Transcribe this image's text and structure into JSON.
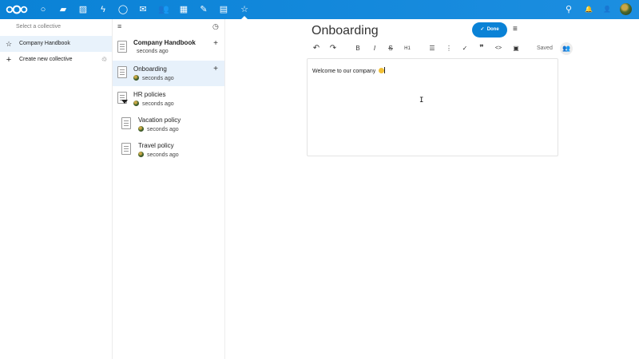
{
  "topbar": {
    "apps": [
      {
        "name": "dashboard-icon",
        "glyph": "○"
      },
      {
        "name": "files-icon",
        "glyph": "▰"
      },
      {
        "name": "photos-icon",
        "glyph": "▨"
      },
      {
        "name": "activity-icon",
        "glyph": "ϟ"
      },
      {
        "name": "talk-icon",
        "glyph": "◯"
      },
      {
        "name": "mail-icon",
        "glyph": "✉"
      },
      {
        "name": "contacts-icon",
        "glyph": "👥"
      },
      {
        "name": "calendar-icon",
        "glyph": "▦"
      },
      {
        "name": "notes-icon",
        "glyph": "✎"
      },
      {
        "name": "deck-icon",
        "glyph": "▤"
      },
      {
        "name": "collectives-icon",
        "glyph": "☆"
      }
    ],
    "right_icons": [
      {
        "name": "search-icon",
        "glyph": "⚲"
      },
      {
        "name": "notifications-icon",
        "glyph": "🔔"
      },
      {
        "name": "contacts-menu-icon",
        "glyph": "👤"
      }
    ]
  },
  "nav": {
    "caption": "Select a collective",
    "items": [
      {
        "label": "Company Handbook",
        "icon": "☆"
      },
      {
        "label": "Create new collective",
        "icon": "+"
      }
    ],
    "restore_icon": "♲"
  },
  "pages": {
    "menu_icon": "≡",
    "history_icon": "◷",
    "items": [
      {
        "title": "Company Handbook",
        "meta": "seconds ago"
      },
      {
        "title": "Onboarding",
        "meta": "seconds ago"
      },
      {
        "title": "HR policies",
        "meta": "seconds ago"
      },
      {
        "title": "Vacation policy",
        "meta": "seconds ago"
      },
      {
        "title": "Travel policy",
        "meta": "seconds ago"
      }
    ]
  },
  "main": {
    "title": "Onboarding",
    "done_label": "Done",
    "more_icon": "≡",
    "saved_label": "Saved",
    "toolbar": [
      {
        "name": "undo-icon",
        "glyph": "↶"
      },
      {
        "name": "redo-icon",
        "glyph": "↷"
      },
      {
        "name": "bold-icon",
        "glyph": "B"
      },
      {
        "name": "italic-icon",
        "glyph": "I"
      },
      {
        "name": "strikethrough-icon",
        "glyph": "S"
      },
      {
        "name": "heading-icon",
        "glyph": "H1"
      },
      {
        "name": "bullet-list-icon",
        "glyph": "☰"
      },
      {
        "name": "numbered-list-icon",
        "glyph": "⋮"
      },
      {
        "name": "checklist-icon",
        "glyph": "✓"
      },
      {
        "name": "blockquote-icon",
        "glyph": "❞"
      },
      {
        "name": "code-block-icon",
        "glyph": "<>"
      },
      {
        "name": "insert-image-icon",
        "glyph": "▣"
      }
    ],
    "editor_text": "Welcome to our company "
  },
  "colors": {
    "accent": "#0a82d6",
    "active_row": "#e7f1fb"
  }
}
